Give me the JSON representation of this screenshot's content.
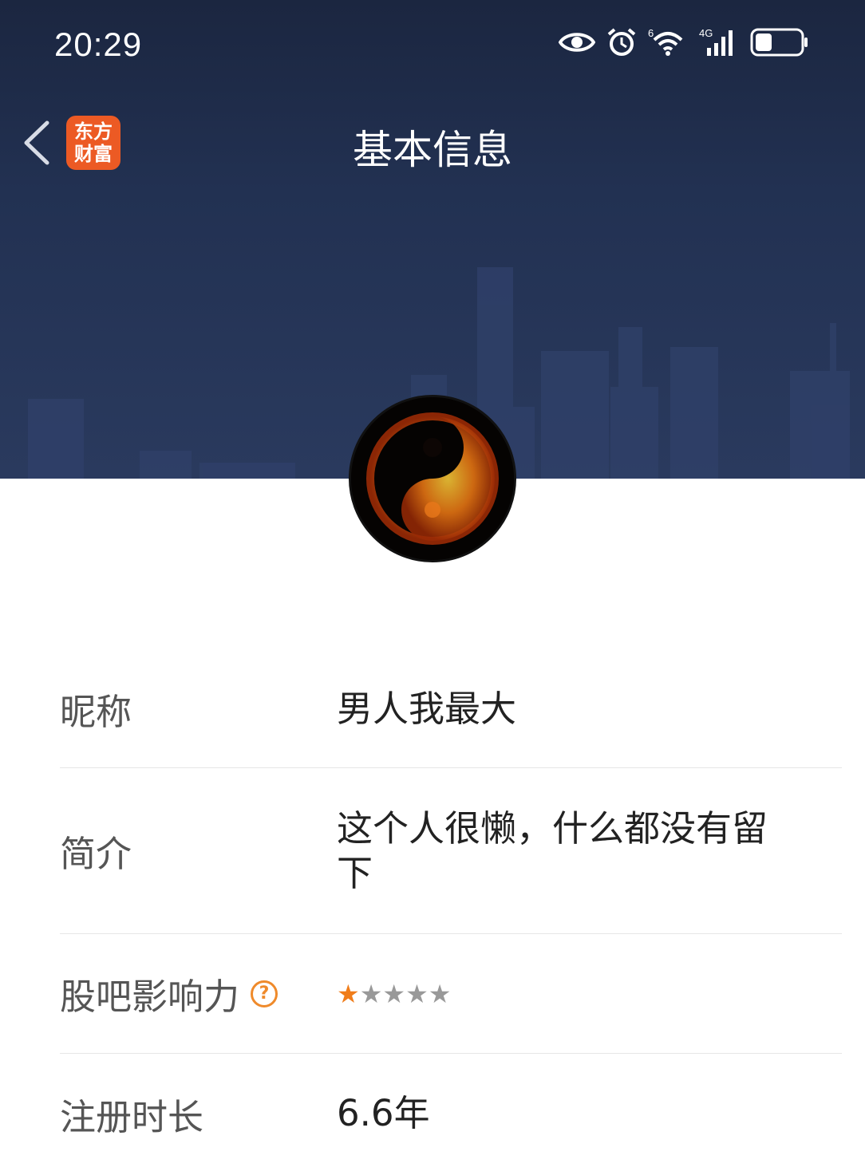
{
  "status_bar": {
    "time": "20:29",
    "icons": [
      "eye-icon",
      "alarm-icon",
      "wifi-icon",
      "signal-icon",
      "battery-icon"
    ],
    "wifi_badge": "6",
    "network_badge": "4G"
  },
  "nav": {
    "title": "基本信息",
    "logo_line1": "东方",
    "logo_line2": "财富"
  },
  "profile": {
    "rows": [
      {
        "label": "昵称",
        "value": "男人我最大"
      },
      {
        "label": "简介",
        "value": "这个人很懒，什么都没有留下"
      },
      {
        "label": "股吧影响力",
        "help": "?",
        "stars_total": 5,
        "stars_filled": 1
      },
      {
        "label": "注册时长",
        "value": "6.6年"
      }
    ]
  },
  "colors": {
    "hero_bg": "#1b2640",
    "accent_orange": "#ef8a2b",
    "logo_bg": "#ec5a24"
  }
}
